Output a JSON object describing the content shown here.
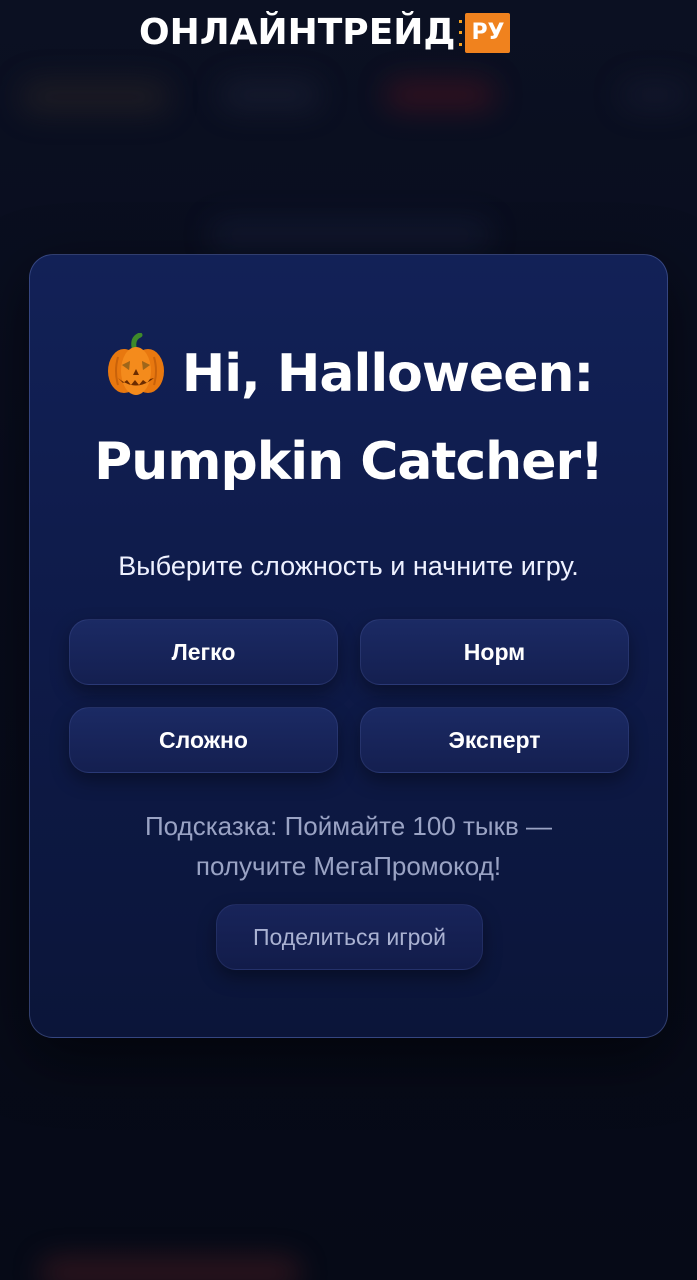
{
  "brand": {
    "name": "ОНЛАЙНТРЕЙД",
    "badge": "РУ",
    "accent_color": "#f0821e"
  },
  "modal": {
    "title_icon": "jack-o-lantern-icon",
    "title_line1": "Hi, Halloween:",
    "title_line2": "Pumpkin Catcher!",
    "subtitle": "Выберите сложность и начните игру.",
    "difficulty": {
      "easy": "Легко",
      "normal": "Норм",
      "hard": "Сложно",
      "expert": "Эксперт"
    },
    "hint_line1": "Подсказка: Поймайте 100 тыкв —",
    "hint_line2": "получите МегаПромокод!",
    "share_label": "Поделиться игрой",
    "background_color": "#122157"
  }
}
